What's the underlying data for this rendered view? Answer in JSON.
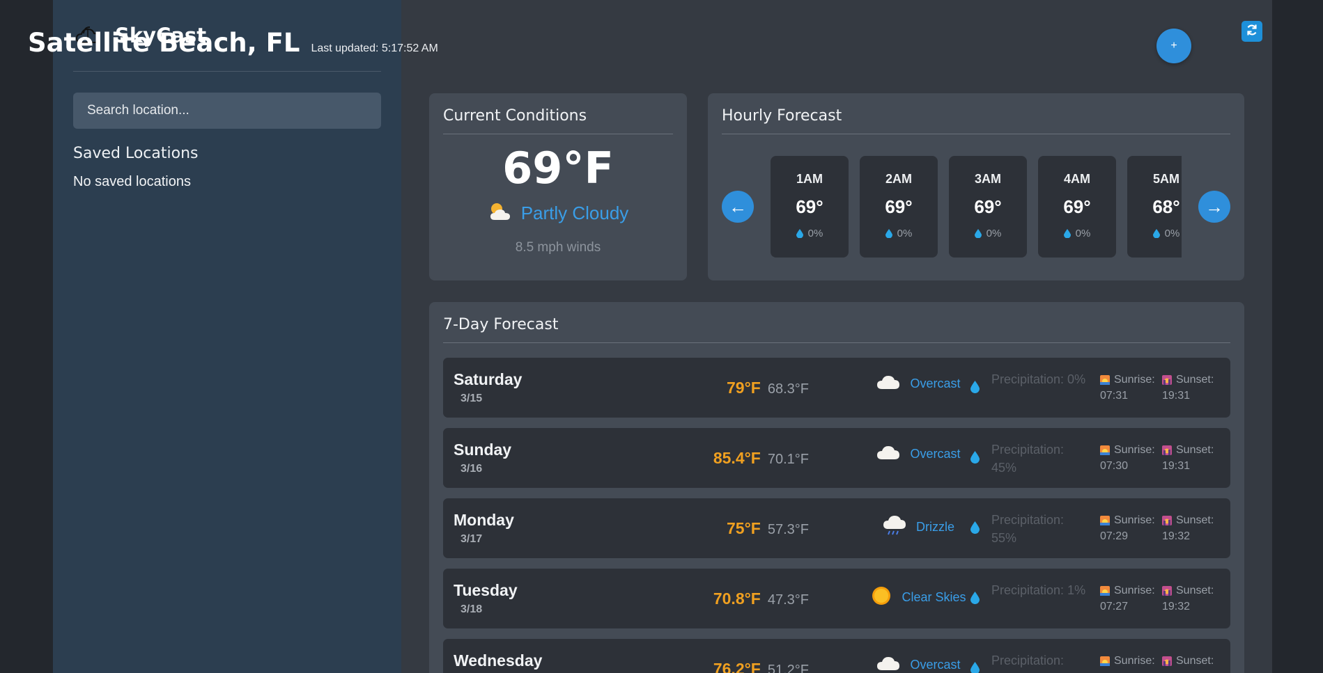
{
  "sidebar": {
    "app_name": "SkyCast",
    "logo_icon": "cloud-sun-outline-icon",
    "search_placeholder": "Search location...",
    "saved_title": "Saved Locations",
    "saved_empty": "No saved locations"
  },
  "header": {
    "location": "Satellite Beach, FL",
    "last_updated": "Last updated: 5:17:52 AM",
    "add_label": "+",
    "refresh_icon": "refresh-icon"
  },
  "current": {
    "title": "Current Conditions",
    "temperature": "69°F",
    "condition": "Partly Cloudy",
    "condition_icon": "partly-cloudy-icon",
    "winds": "8.5 mph winds"
  },
  "hourly": {
    "title": "Hourly Forecast",
    "prev_label": "←",
    "next_label": "→",
    "hours": [
      {
        "label": "1AM",
        "temp": "69°",
        "precip": "0%"
      },
      {
        "label": "2AM",
        "temp": "69°",
        "precip": "0%"
      },
      {
        "label": "3AM",
        "temp": "69°",
        "precip": "0%"
      },
      {
        "label": "4AM",
        "temp": "69°",
        "precip": "0%"
      },
      {
        "label": "5AM",
        "temp": "68°",
        "precip": "0%"
      }
    ]
  },
  "daily": {
    "title": "7-Day Forecast",
    "days": [
      {
        "name": "Saturday",
        "date": "3/15",
        "high": "79°F",
        "low": "68.3°F",
        "condition": "Overcast",
        "icon": "cloud-icon",
        "precip": "Precipitation: 0%",
        "sunrise_label": "Sunrise:",
        "sunrise": "07:31",
        "sunset_label": "Sunset:",
        "sunset": "19:31"
      },
      {
        "name": "Sunday",
        "date": "3/16",
        "high": "85.4°F",
        "low": "70.1°F",
        "condition": "Overcast",
        "icon": "cloud-icon",
        "precip": "Precipitation: 45%",
        "sunrise_label": "Sunrise:",
        "sunrise": "07:30",
        "sunset_label": "Sunset:",
        "sunset": "19:31"
      },
      {
        "name": "Monday",
        "date": "3/17",
        "high": "75°F",
        "low": "57.3°F",
        "condition": "Drizzle",
        "icon": "drizzle-icon",
        "precip": "Precipitation: 55%",
        "sunrise_label": "Sunrise:",
        "sunrise": "07:29",
        "sunset_label": "Sunset:",
        "sunset": "19:32"
      },
      {
        "name": "Tuesday",
        "date": "3/18",
        "high": "70.8°F",
        "low": "47.3°F",
        "condition": "Clear Skies",
        "icon": "sun-icon",
        "precip": "Precipitation: 1%",
        "sunrise_label": "Sunrise:",
        "sunrise": "07:27",
        "sunset_label": "Sunset:",
        "sunset": "19:32"
      },
      {
        "name": "Wednesday",
        "date": "",
        "high": "76.2°F",
        "low": "51.2°F",
        "condition": "Overcast",
        "icon": "cloud-icon",
        "precip": "Precipitation:",
        "sunrise_label": "Sunrise:",
        "sunrise": "",
        "sunset_label": "Sunset:",
        "sunset": ""
      }
    ]
  },
  "colors": {
    "accent": "#2f8fdb",
    "high_temp": "#f0a020",
    "condition_text": "#3a9ee8",
    "sidebar_bg": "#2c3e50",
    "main_bg": "#353a42",
    "card_bg": "#444b55",
    "row_bg": "#2d3138"
  }
}
